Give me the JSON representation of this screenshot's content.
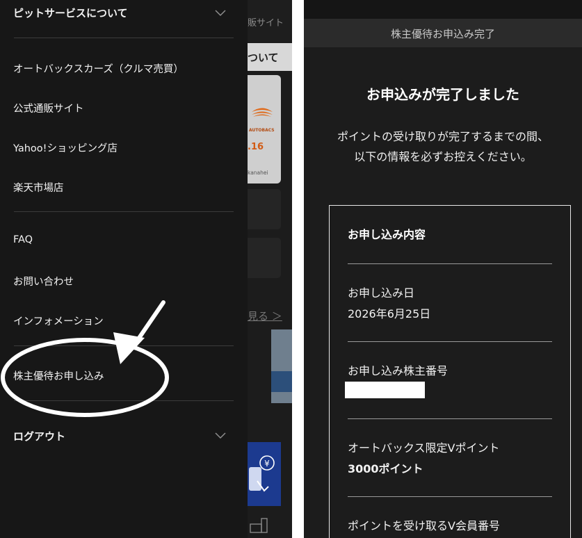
{
  "menu": {
    "section_pit": "ピットサービスについて",
    "items_group1": [
      "オートバックスカーズ（クルマ売買）",
      "公式通販サイト",
      "Yahoo!ショッピング店",
      "楽天市場店"
    ],
    "items_group2": [
      "FAQ",
      "お問い合わせ",
      "インフォメーション"
    ],
    "highlighted_item": "株主優待お申し込み",
    "logout": "ログアウト"
  },
  "background_page": {
    "site_fragment": "販サイト",
    "tab_fragment": "ついて",
    "card_number_fragment": ".16",
    "card_kana_fragment": "kanahei",
    "more_link_fragment": "見る ＞"
  },
  "completion": {
    "header": "株主優待お申込み完了",
    "title": "お申込みが完了しました",
    "description": "ポイントの受け取りが完了するまでの間、 以下の情報を必ずお控えください。",
    "box_title": "お申し込み内容",
    "fields": [
      {
        "label": "お申し込み日",
        "value": "2026年6月25日"
      },
      {
        "label": "お申し込み株主番号",
        "value": ""
      },
      {
        "label": "オートバックス限定Vポイント",
        "value": "3000ポイント"
      },
      {
        "label": "ポイントを受け取るV会員番号",
        "value": ""
      }
    ]
  },
  "colors": {
    "menu_background": "#171717",
    "panel_background": "#1c1c1c",
    "header_background": "#2b2b2b",
    "annotation": "#ffffff"
  }
}
